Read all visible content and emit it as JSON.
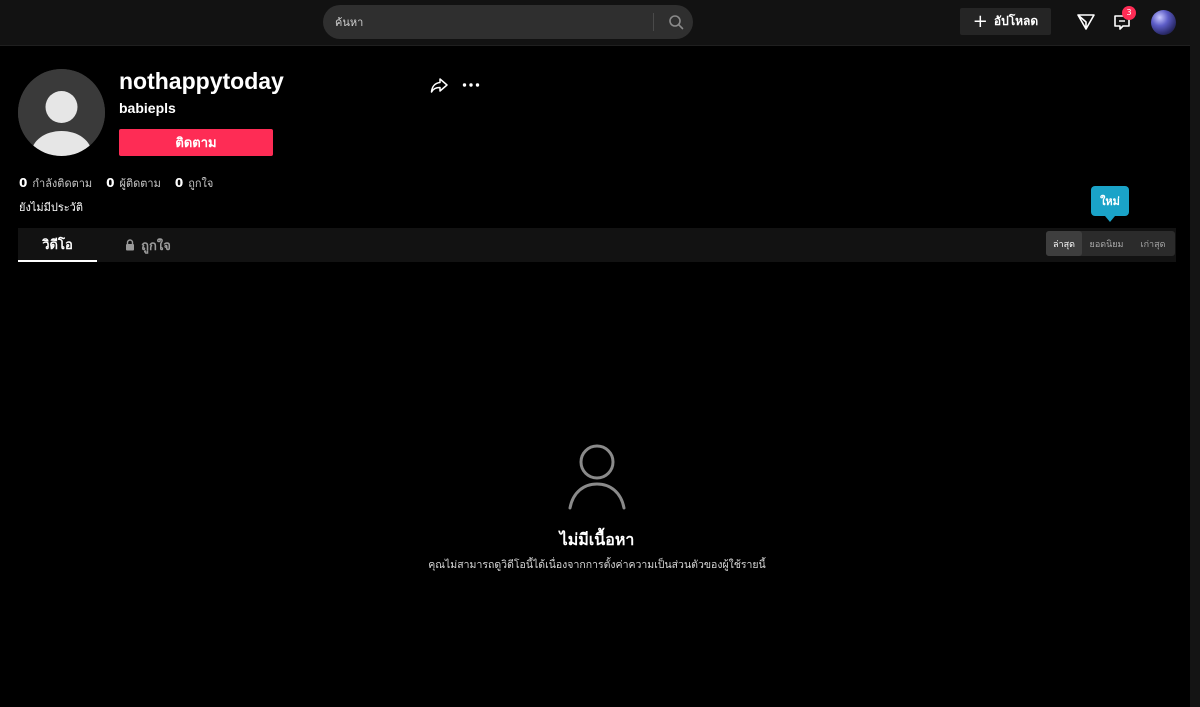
{
  "topbar": {
    "search_placeholder": "ค้นหา",
    "upload_label": "อัปโหลด",
    "inbox_badge": "3",
    "icons": {
      "search": "search-icon",
      "upload": "plus-icon",
      "messages": "send-icon",
      "inbox": "inbox-icon"
    }
  },
  "profile": {
    "username": "nothappytoday",
    "nickname": "babiepls",
    "follow_label": "ติดตาม",
    "stats": [
      {
        "count": "0",
        "label": "กำลังติดตาม"
      },
      {
        "count": "0",
        "label": "ผู้ติดตาม"
      },
      {
        "count": "0",
        "label": "ถูกใจ"
      }
    ],
    "bio": "ยังไม่มีประวัติ"
  },
  "tabs": {
    "videos_label": "วิดีโอ",
    "liked_label": "ถูกใจ"
  },
  "sort": {
    "tooltip": "ใหม่",
    "options": [
      "ล่าสุด",
      "ยอดนิยม",
      "เก่าสุด"
    ],
    "active": "ล่าสุด"
  },
  "empty_state": {
    "title": "ไม่มีเนื้อหา",
    "description": "คุณไม่สามารถดูวิดีโอนี้ได้เนื่องจากการตั้งค่าความเป็นส่วนตัวของผู้ใช้รายนี้"
  },
  "colors": {
    "accent": "#fe2c55",
    "tooltip": "#1aa3c8",
    "background": "#000000",
    "topbar": "#121212"
  }
}
